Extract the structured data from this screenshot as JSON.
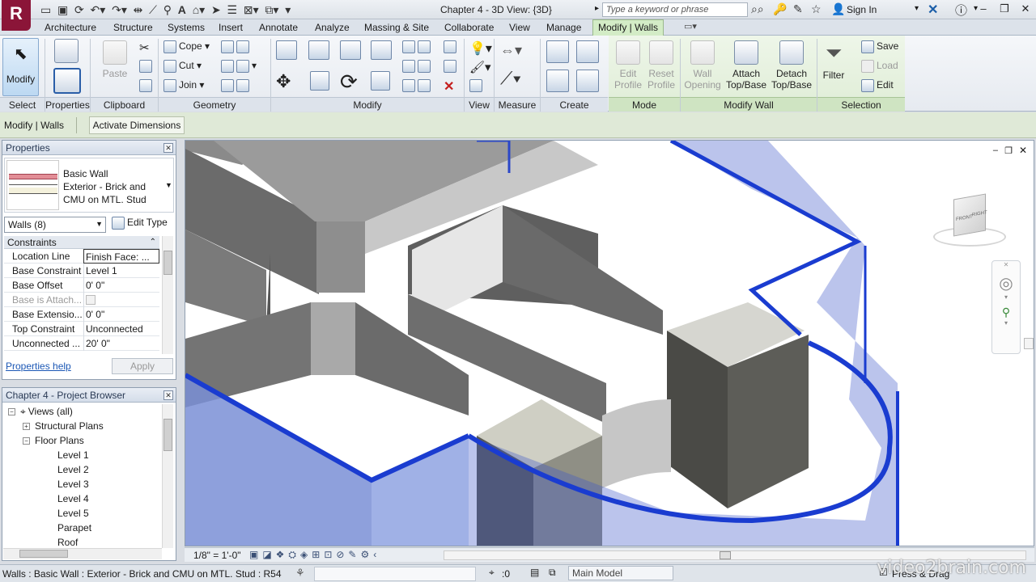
{
  "app": {
    "title": "Chapter 4 - 3D View: {3D}",
    "search_placeholder": "Type a keyword or phrase",
    "sign_in": "Sign In",
    "accent": "#8b1538"
  },
  "tabs": [
    "Architecture",
    "Structure",
    "Systems",
    "Insert",
    "Annotate",
    "Analyze",
    "Massing & Site",
    "Collaborate",
    "View",
    "Manage",
    "Modify | Walls"
  ],
  "ribbon": {
    "select": {
      "modify_label": "Modify",
      "panel": "Select"
    },
    "properties": {
      "panel": "Properties"
    },
    "clipboard": {
      "paste": "Paste",
      "panel": "Clipboard"
    },
    "geometry": {
      "cope": "Cope",
      "cut": "Cut",
      "join": "Join",
      "panel": "Geometry"
    },
    "modify_panel": "Modify",
    "view_panel": "View",
    "measure_panel": "Measure",
    "create_panel": "Create",
    "mode": {
      "edit_profile": "Edit Profile",
      "reset_profile": "Reset Profile",
      "panel": "Mode"
    },
    "modify_wall": {
      "wall_opening": "Wall Opening",
      "attach": "Attach Top/Base",
      "detach": "Detach Top/Base",
      "panel": "Modify Wall"
    },
    "selection": {
      "filter": "Filter",
      "save": "Save",
      "load": "Load",
      "edit": "Edit",
      "panel": "Selection"
    }
  },
  "options_bar": {
    "title": "Modify | Walls",
    "activate_dimensions": "Activate Dimensions"
  },
  "properties": {
    "header": "Properties",
    "type_line1": "Basic Wall",
    "type_line2": "Exterior - Brick and",
    "type_line3": "CMU on MTL. Stud",
    "instance_selector": "Walls (8)",
    "edit_type": "Edit Type",
    "group": "Constraints",
    "rows": [
      {
        "name": "Location Line",
        "value": "Finish Face: ..."
      },
      {
        "name": "Base Constraint",
        "value": "Level 1"
      },
      {
        "name": "Base Offset",
        "value": "0'  0\""
      },
      {
        "name": "Base is Attach...",
        "value": ""
      },
      {
        "name": "Base Extensio...",
        "value": "0'  0\""
      },
      {
        "name": "Top Constraint",
        "value": "Unconnected"
      },
      {
        "name": "Unconnected ...",
        "value": "20'  0\""
      }
    ],
    "help": "Properties help",
    "apply": "Apply"
  },
  "browser": {
    "header": "Chapter 4 - Project Browser",
    "items": [
      {
        "label": "Views (all)",
        "level": 0,
        "toggle": "−"
      },
      {
        "label": "Structural Plans",
        "level": 1,
        "toggle": "+"
      },
      {
        "label": "Floor Plans",
        "level": 1,
        "toggle": "−"
      },
      {
        "label": "Level 1",
        "level": 2
      },
      {
        "label": "Level 2",
        "level": 2
      },
      {
        "label": "Level 3",
        "level": 2
      },
      {
        "label": "Level 4",
        "level": 2
      },
      {
        "label": "Level 5",
        "level": 2
      },
      {
        "label": "Parapet",
        "level": 2
      },
      {
        "label": "Roof",
        "level": 2
      }
    ]
  },
  "view_control": {
    "scale": "1/8\" = 1'-0\""
  },
  "viewcube": {
    "front": "FRONT",
    "right": "RIGHT"
  },
  "status": {
    "text": "Walls : Basic Wall : Exterior - Brick and CMU on MTL. Stud : R54",
    "count": ":0",
    "model": "Main Model",
    "drag": "Press & Drag"
  },
  "watermark": "video2brain.com"
}
